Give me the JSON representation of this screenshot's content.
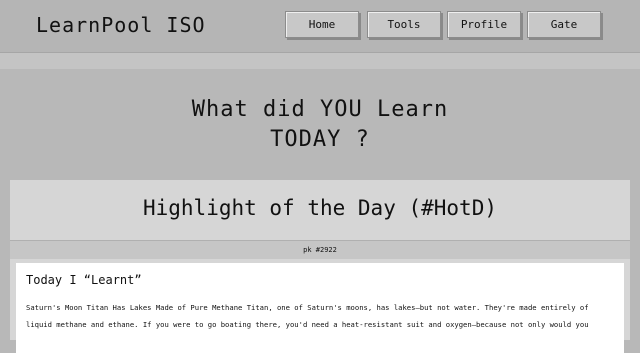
{
  "header": {
    "logo": "LearnPool ISO",
    "nav": [
      {
        "label": "Home"
      },
      {
        "label": "Tools"
      },
      {
        "label": "Profile"
      },
      {
        "label": "Gate"
      }
    ]
  },
  "hero": {
    "line1": "What did YOU Learn",
    "line2": "TODAY ?"
  },
  "highlight": {
    "title": "Highlight of the Day (#HotD)",
    "pk": "pk #2922",
    "post_heading": "Today I “Learnt”",
    "post_line1": "Saturn's Moon Titan Has Lakes Made of Pure Methane Titan, one of Saturn's moons, has lakes—but not water. They're made entirely of",
    "post_line2": "liquid methane and ethane. If you were to go boating there, you'd need a heat-resistant suit and oxygen—because not only would you"
  }
}
